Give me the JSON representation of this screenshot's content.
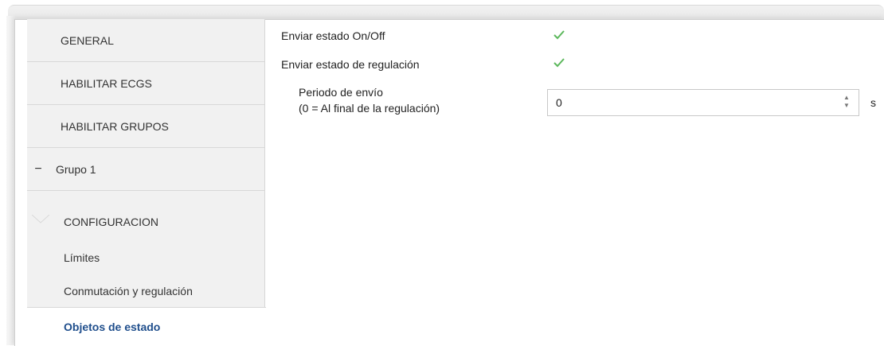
{
  "sidebar": {
    "items": [
      {
        "label": "GENERAL"
      },
      {
        "label": "HABILITAR ECGS"
      },
      {
        "label": "HABILITAR GRUPOS"
      }
    ],
    "group": {
      "label": "Grupo 1",
      "collapse_symbol": "−"
    },
    "sub_items": [
      {
        "label": "CONFIGURACION"
      },
      {
        "label": "Límites"
      },
      {
        "label": "Conmutación y regulación"
      },
      {
        "label": "Objetos de estado"
      }
    ],
    "active_index": 3
  },
  "main": {
    "send_onoff": {
      "label": "Enviar estado On/Off",
      "checked": true
    },
    "send_regulation": {
      "label": "Enviar estado de regulación",
      "checked": true
    },
    "send_period": {
      "label_line1": "Periodo de envío",
      "label_line2": "(0 = Al final de la regulación)",
      "value": "0",
      "unit": "s"
    }
  },
  "colors": {
    "check": "#5cb85c",
    "active_text": "#1f4e8c",
    "sidebar_bg": "#f1f1f1"
  }
}
